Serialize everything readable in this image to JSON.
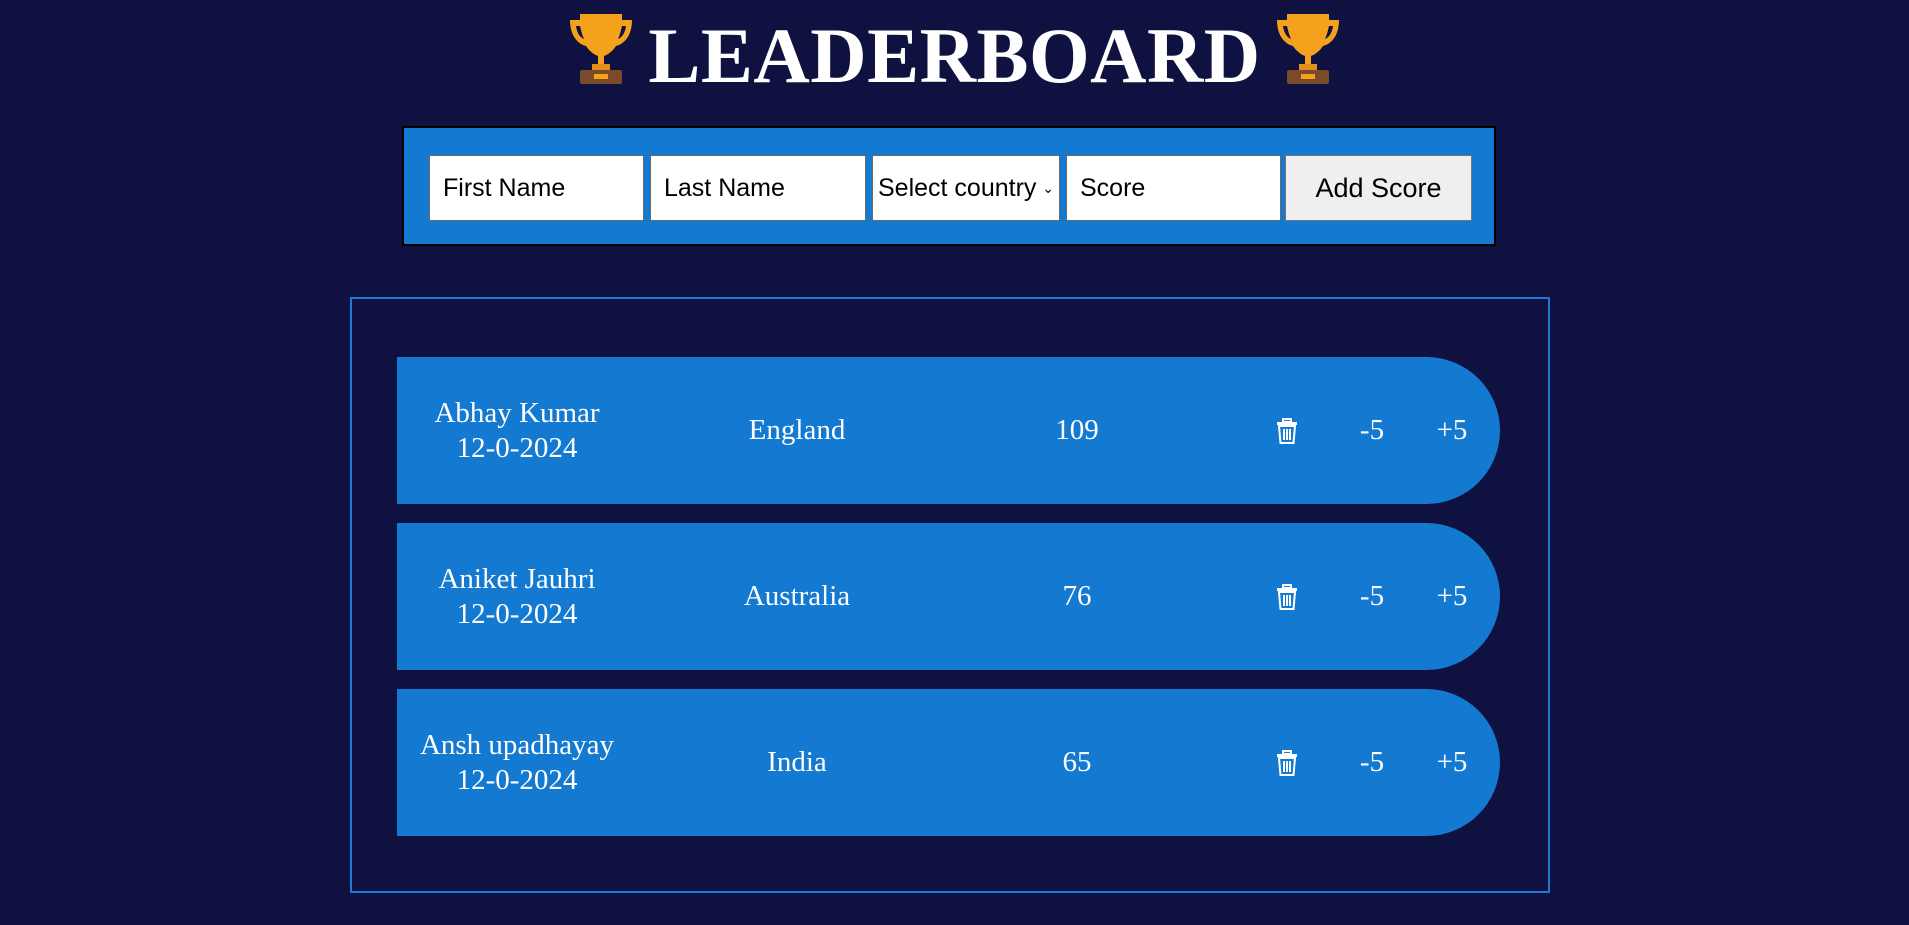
{
  "header": {
    "title": "LEADERBOARD",
    "icon_left": "trophy-icon",
    "icon_right": "trophy-icon"
  },
  "form": {
    "first_name_placeholder": "First Name",
    "last_name_placeholder": "Last Name",
    "country_select_value": "Select country",
    "score_placeholder": "Score",
    "add_button_label": "Add Score"
  },
  "entries": [
    {
      "name": "Abhay Kumar",
      "date": "12-0-2024",
      "country": "England",
      "score": "109",
      "minus_label": "-5",
      "plus_label": "+5",
      "delete_icon": "trash-icon"
    },
    {
      "name": "Aniket Jauhri",
      "date": "12-0-2024",
      "country": "Australia",
      "score": "76",
      "minus_label": "-5",
      "plus_label": "+5",
      "delete_icon": "trash-icon"
    },
    {
      "name": "Ansh upadhayay",
      "date": "12-0-2024",
      "country": "India",
      "score": "65",
      "minus_label": "-5",
      "plus_label": "+5",
      "delete_icon": "trash-icon"
    }
  ],
  "colors": {
    "background": "#0f1240",
    "accent": "#1479d0",
    "text": "#ffffff"
  }
}
